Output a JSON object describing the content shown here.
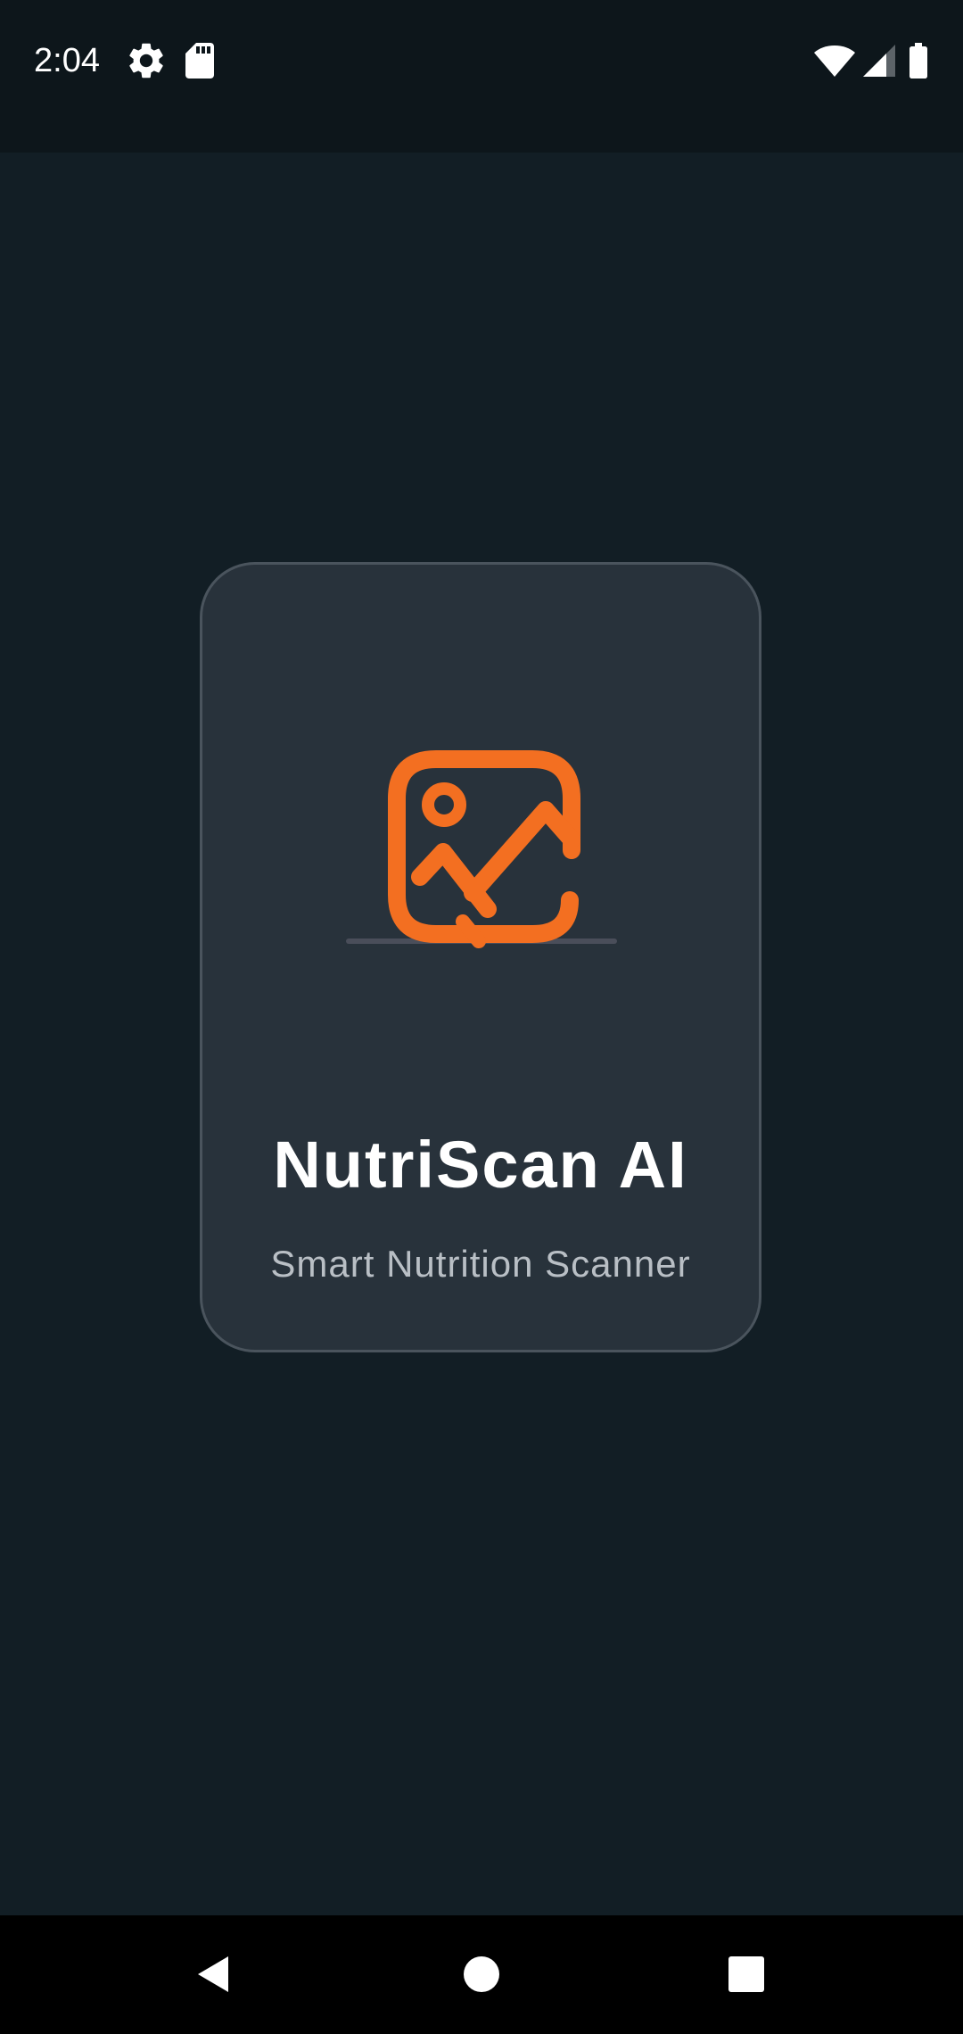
{
  "status_bar": {
    "time": "2:04",
    "left_icons": [
      "gear-icon",
      "sd-card-icon"
    ],
    "right_icons": [
      "wifi-icon",
      "cell-signal-icon",
      "battery-icon"
    ]
  },
  "splash": {
    "icon": "image-icon",
    "title": "NutriScan AI",
    "subtitle": "Smart Nutrition Scanner"
  },
  "nav_bar": {
    "buttons": [
      "back-icon",
      "home-icon",
      "recents-icon"
    ]
  },
  "colors": {
    "background": "#121e25",
    "status_bar": "#0d161b",
    "card": "#28323b",
    "card_border": "#4a545d",
    "accent": "#f36f21",
    "title": "#ffffff",
    "subtitle": "#b9bfc5"
  }
}
